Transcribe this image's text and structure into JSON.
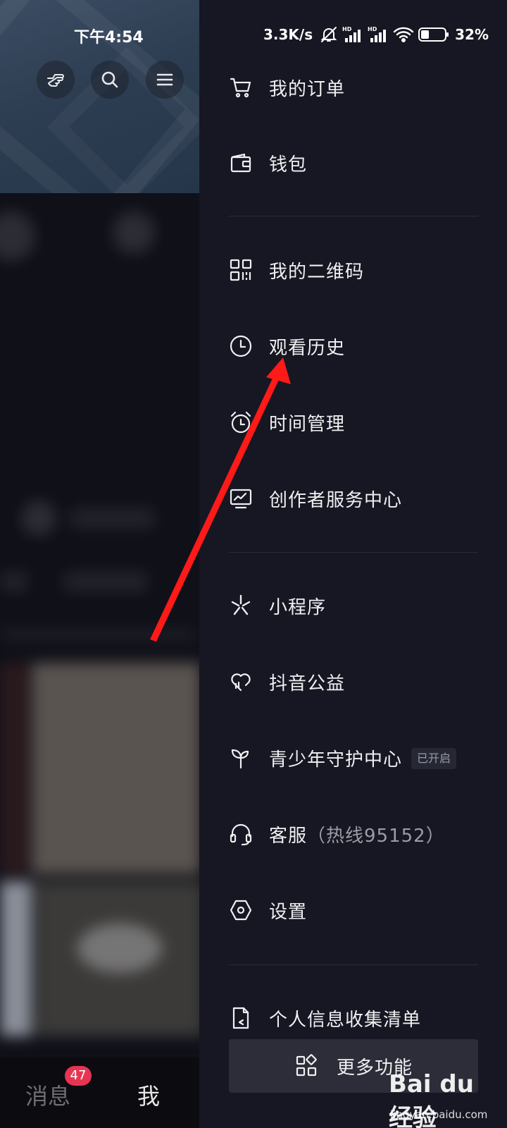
{
  "status_bar": {
    "time": "下午4:54",
    "net_speed": "3.3K/s",
    "battery_text": "32%",
    "icons": [
      "mute-icon",
      "hd-signal-icon",
      "hd-signal-icon",
      "wifi-icon",
      "battery-icon"
    ]
  },
  "profile_page": {
    "top_buttons": [
      "hand-pointer-icon",
      "search-icon",
      "menu-icon"
    ],
    "tab_bar": {
      "messages_label": "消息",
      "messages_badge": "47",
      "me_label": "我"
    }
  },
  "drawer": {
    "menu_items": [
      {
        "label": "我的订单",
        "icon": "cart-icon"
      },
      {
        "label": "钱包",
        "icon": "wallet-icon"
      },
      {
        "label": "我的二维码",
        "icon": "qr-code-icon"
      },
      {
        "label": "观看历史",
        "icon": "clock-icon"
      },
      {
        "label": "时间管理",
        "icon": "alarm-icon"
      },
      {
        "label": "创作者服务中心",
        "icon": "chart-monitor-icon"
      },
      {
        "label": "小程序",
        "icon": "mini-program-icon"
      },
      {
        "label": "抖音公益",
        "icon": "heart-charity-icon"
      },
      {
        "label": "青少年守护中心",
        "icon": "sprout-icon",
        "badge": "已开启"
      },
      {
        "label": "客服",
        "label_extra": "（热线95152）",
        "icon": "headset-icon"
      },
      {
        "label": "设置",
        "icon": "settings-hexagon-icon"
      },
      {
        "label": "个人信息收集清单",
        "icon": "document-icon"
      }
    ],
    "more_button_label": "更多功能",
    "more_button_icon": "apps-grid-icon"
  },
  "annotation": {
    "color": "#ff1a1a",
    "target": "观看历史"
  },
  "watermark": {
    "logo": "Bai du 经验",
    "url": "jingyan.baidu.com"
  },
  "colors": {
    "drawer_bg": "#161722",
    "badge_red": "#e63553",
    "divider": "#2a2b36"
  }
}
